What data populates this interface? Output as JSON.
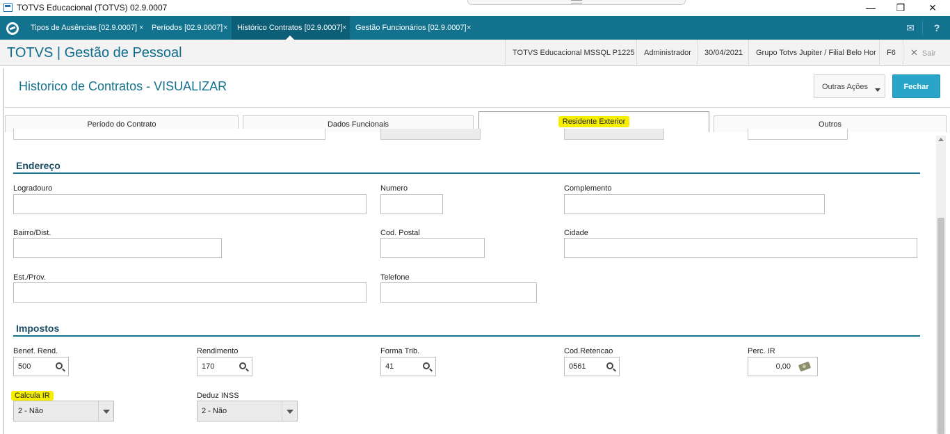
{
  "window": {
    "title": "TOTVS Educacional (TOTVS) 02.9.0007",
    "minimize": "—",
    "restore": "❐",
    "close": "✕"
  },
  "app_tabs": [
    {
      "label": "Tipos de Ausências [02.9.0007]",
      "close": "×"
    },
    {
      "label": "Períodos [02.9.0007]",
      "close": "×"
    },
    {
      "label": "Histórico Contratos [02.9.0007]",
      "close": "×"
    },
    {
      "label": "Gestão Funcionários [02.9.0007]",
      "close": "×"
    }
  ],
  "header_icons": {
    "mail": "✉",
    "help": "?"
  },
  "header": {
    "brand": "TOTVS | Gestão de Pessoal",
    "environment": "TOTVS Educacional MSSQL P1225",
    "user": "Administrador",
    "date": "30/04/2021",
    "company": "Grupo Totvs Jupiter / Filial Belo Hor",
    "shortcut": "F6",
    "logout_icon": "✕",
    "logout": "Sair"
  },
  "page": {
    "title": "Historico de Contratos - VISUALIZAR",
    "other_actions": "Outras Ações",
    "close_button": "Fechar"
  },
  "form_tabs": [
    "Período do Contrato",
    "Dados Funcionais",
    "Residente Exterior",
    "Outros"
  ],
  "endereco": {
    "title": "Endereço",
    "logradouro": {
      "label": "Logradouro",
      "value": ""
    },
    "numero": {
      "label": "Numero",
      "value": ""
    },
    "complemento": {
      "label": "Complemento",
      "value": ""
    },
    "bairro": {
      "label": "Bairro/Dist.",
      "value": ""
    },
    "cod_postal": {
      "label": "Cod. Postal",
      "value": ""
    },
    "cidade": {
      "label": "Cidade",
      "value": ""
    },
    "est_prov": {
      "label": "Est./Prov.",
      "value": ""
    },
    "telefone": {
      "label": "Telefone",
      "value": ""
    }
  },
  "impostos": {
    "title": "Impostos",
    "benef_rend": {
      "label": "Benef. Rend.",
      "value": "500"
    },
    "rendimento": {
      "label": "Rendimento",
      "value": "170"
    },
    "forma_trib": {
      "label": "Forma Trib.",
      "value": "41"
    },
    "cod_retencao": {
      "label": "Cod.Retencao",
      "value": "0561"
    },
    "perc_ir": {
      "label": "Perc. IR",
      "value": "0,00"
    },
    "calcula_ir": {
      "label": "Calcula IR",
      "value": "2 - Não"
    },
    "deduz_inss": {
      "label": "Deduz INSS",
      "value": "2 - Não"
    }
  },
  "colors": {
    "accent": "#13728d",
    "primary_button": "#2aa5c8",
    "highlight": "#f6f000"
  }
}
